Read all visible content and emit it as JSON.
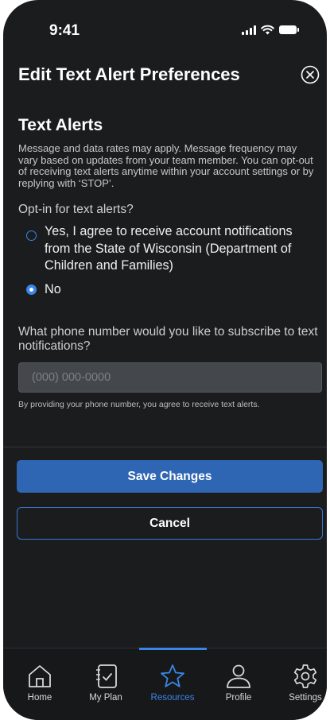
{
  "status_bar": {
    "time": "9:41"
  },
  "header": {
    "title": "Edit Text Alert Preferences"
  },
  "text_alerts": {
    "title": "Text Alerts",
    "disclaimer": "Message and data rates may apply. Message frequency may vary based on updates from your team member. You can opt-out of receiving text alerts anytime within your account settings or by replying with ‘STOP’.",
    "question": "Opt-in for text alerts?",
    "options": [
      {
        "label": "Yes, I agree to receive account notifications from the State of Wisconsin (Department of Children and Families)",
        "selected": false
      },
      {
        "label": "No",
        "selected": true
      }
    ]
  },
  "phone": {
    "question": "What phone number would you like to subscribe to text notifications?",
    "placeholder": "(000) 000-0000",
    "value": "",
    "note": "By providing your phone number, you agree to receive text alerts."
  },
  "actions": {
    "save_label": "Save Changes",
    "cancel_label": "Cancel"
  },
  "tabs": [
    {
      "label": "Home",
      "icon": "home-icon",
      "active": false
    },
    {
      "label": "My Plan",
      "icon": "checklist-icon",
      "active": false
    },
    {
      "label": "Resources",
      "icon": "star-icon",
      "active": true
    },
    {
      "label": "Profile",
      "icon": "person-icon",
      "active": false
    },
    {
      "label": "Settings",
      "icon": "gear-icon",
      "active": false
    }
  ],
  "colors": {
    "accent": "#3a86e8",
    "primary_button": "#2f66b3",
    "background": "#1b1c1e"
  }
}
